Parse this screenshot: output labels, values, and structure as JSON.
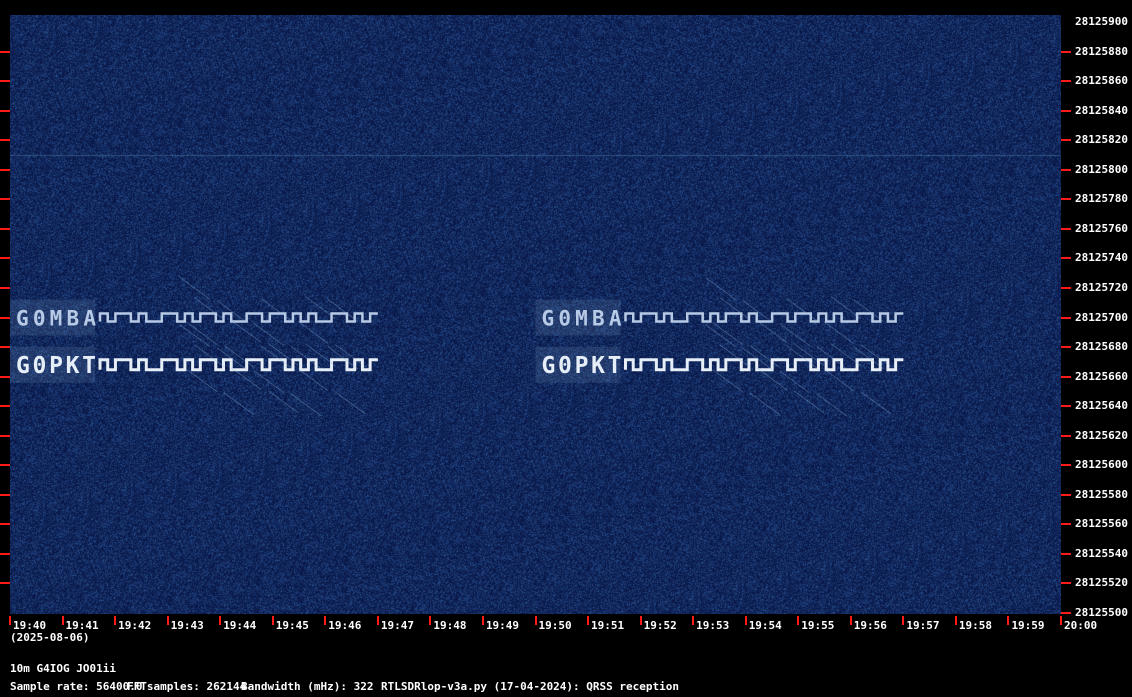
{
  "chart_data": {
    "type": "heatmap",
    "title": "",
    "xlabel": "",
    "ylabel": "",
    "x_ticks": [
      "19:40",
      "19:41",
      "19:42",
      "19:43",
      "19:44",
      "19:45",
      "19:46",
      "19:47",
      "19:48",
      "19:49",
      "19:50",
      "19:51",
      "19:52",
      "19:53",
      "19:54",
      "19:55",
      "19:56",
      "19:57",
      "19:58",
      "19:59",
      "20:00"
    ],
    "y_ticks": [
      28125900,
      28125880,
      28125860,
      28125840,
      28125820,
      28125800,
      28125780,
      28125760,
      28125740,
      28125720,
      28125700,
      28125680,
      28125660,
      28125640,
      28125620,
      28125600,
      28125580,
      28125560,
      28125540,
      28125520,
      28125500
    ],
    "xlim": [
      "19:40",
      "20:00"
    ],
    "ylim": [
      28125500,
      28125900
    ],
    "colors": {
      "background": "#0d1d55",
      "tick": "#ff1a1a",
      "signal": "#dfe8f4"
    },
    "signals": [
      {
        "callsign": "G0MBA",
        "frequency": 28125700,
        "occurrences": [
          {
            "start": "19:40",
            "end": "19:47"
          },
          {
            "start": "19:50",
            "end": "19:57"
          }
        ]
      },
      {
        "callsign": "G0PKT",
        "frequency": 28125668,
        "occurrences": [
          {
            "start": "19:40",
            "end": "19:47"
          },
          {
            "start": "19:50",
            "end": "19:57"
          }
        ]
      }
    ]
  },
  "date": "(2025-08-06)",
  "footer": {
    "station": "10m G4IOG JO01ii",
    "sample_rate": "Sample rate: 56400.0",
    "fft_samples": "FFTsamples: 262144",
    "bandwidth": "Bandwidth (mHz): 322",
    "software": "RTLSDRlop-v3a.py (17-04-2024): QRSS reception"
  }
}
